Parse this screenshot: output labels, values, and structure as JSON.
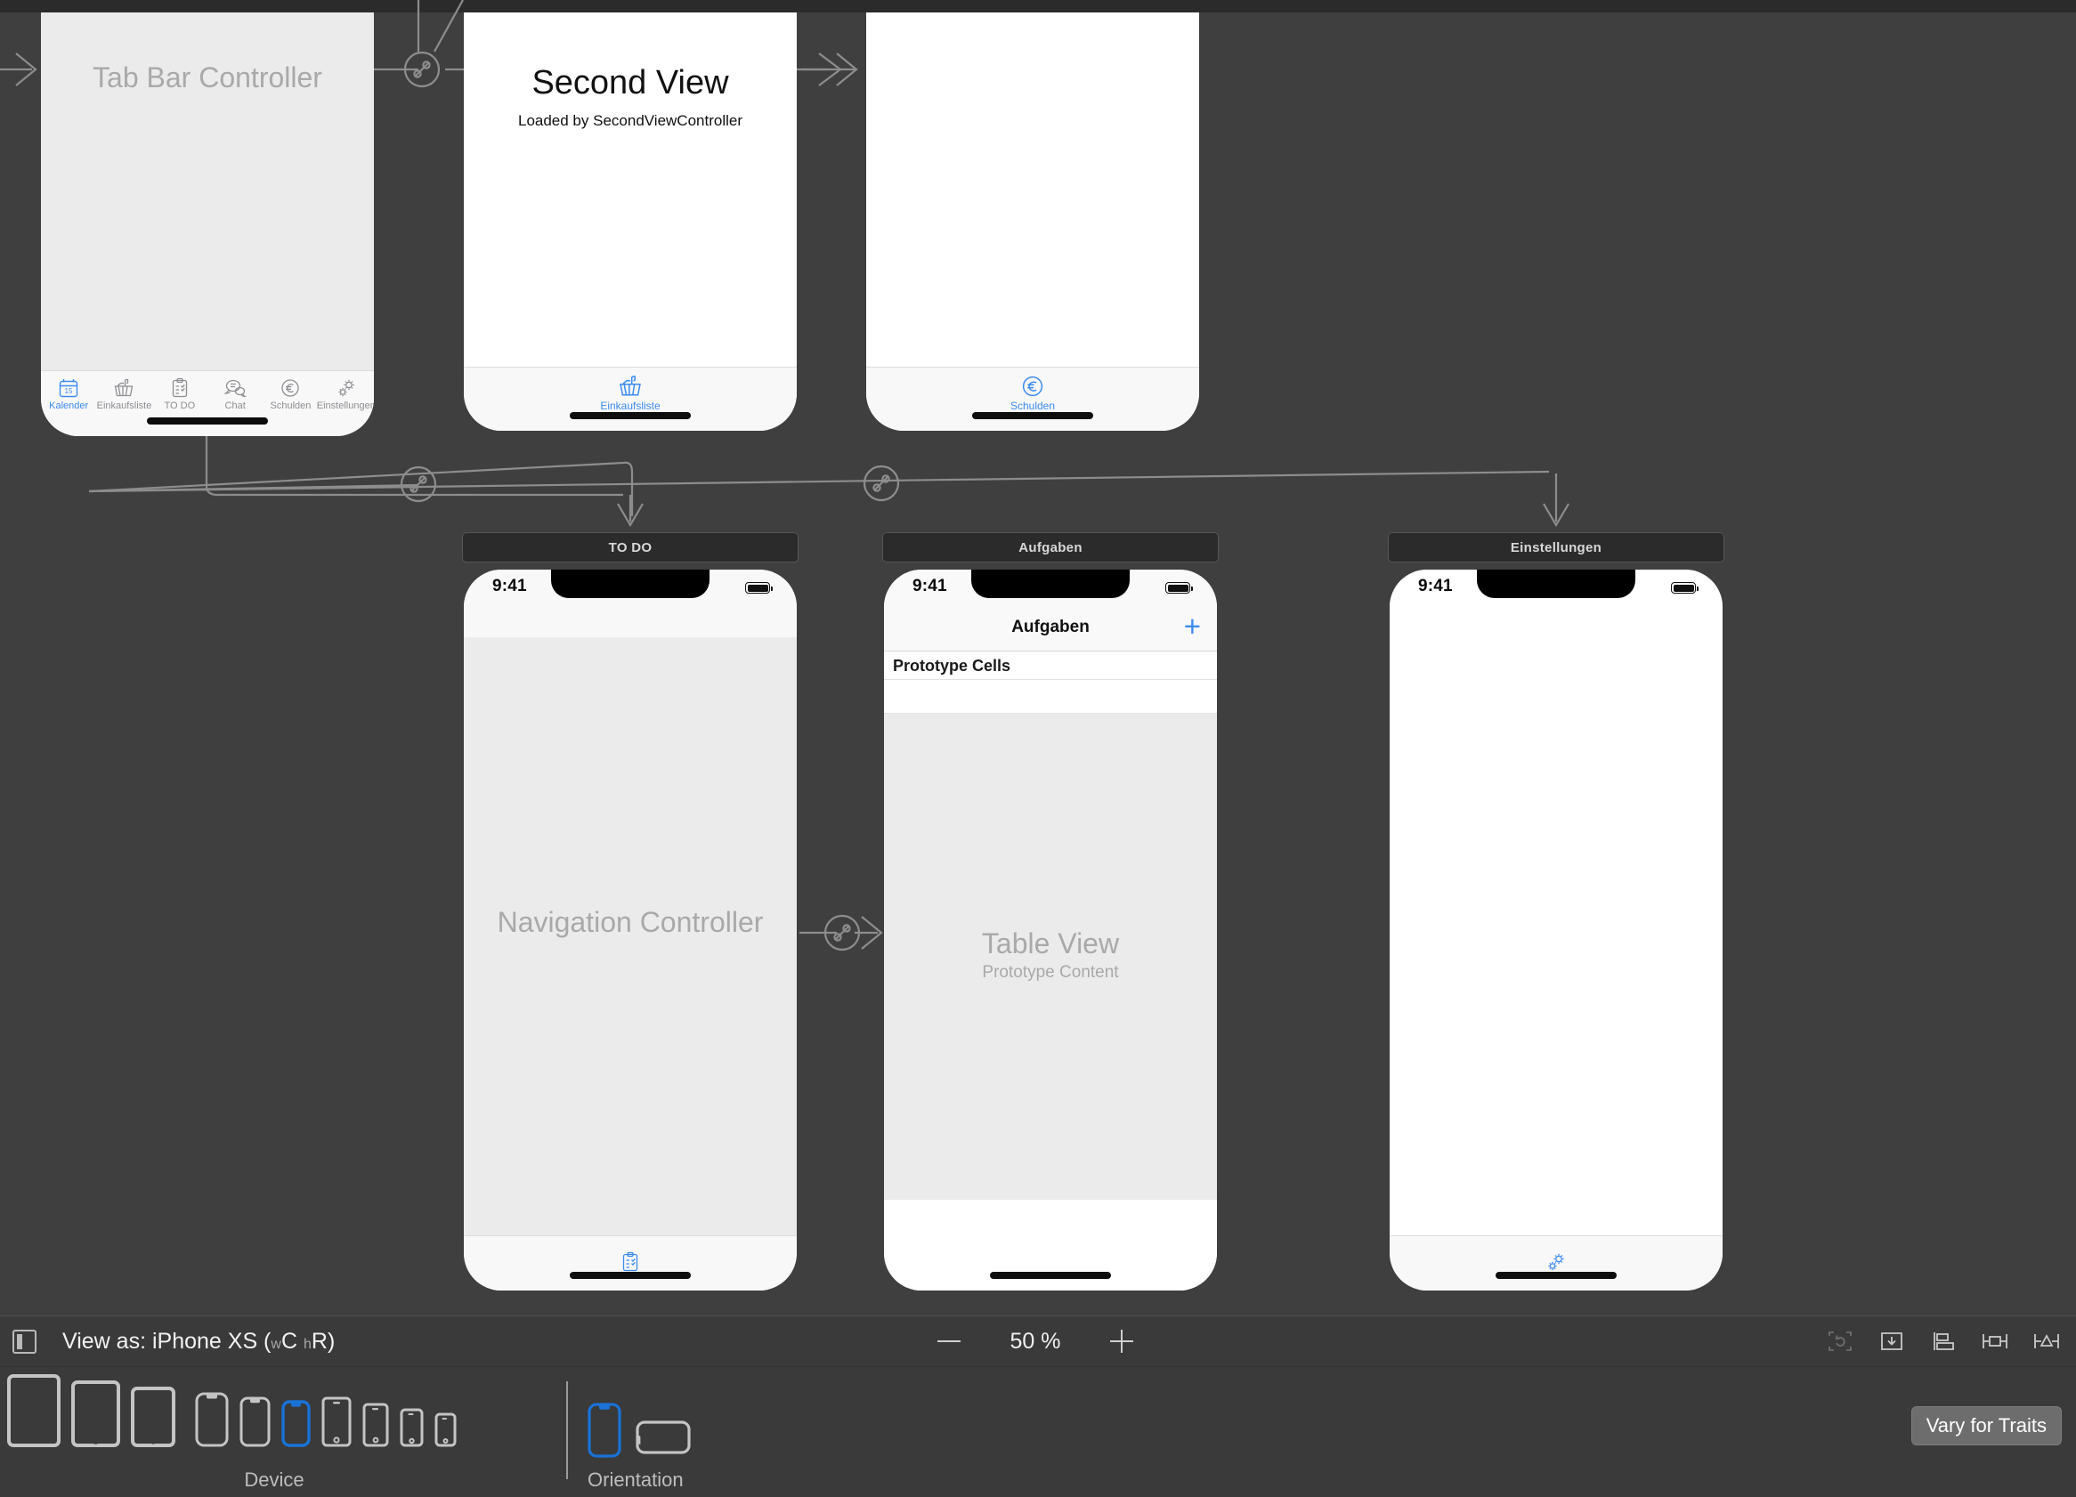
{
  "app": {
    "editor": "xcode-interface-builder-storyboard"
  },
  "canvas": {
    "scenes": [
      {
        "id": "tab-bar-controller",
        "placeholder_title": "Tab Bar Controller",
        "placeholder_sub": "",
        "tabbar": {
          "items": [
            {
              "label": "Kalender",
              "icon": "calendar-icon",
              "active": true
            },
            {
              "label": "Einkaufsliste",
              "icon": "basket-icon",
              "active": false
            },
            {
              "label": "TO DO",
              "icon": "clipboard-icon",
              "active": false
            },
            {
              "label": "Chat",
              "icon": "chat-bubbles-icon",
              "active": false
            },
            {
              "label": "Schulden",
              "icon": "euro-circle-icon",
              "active": false
            },
            {
              "label": "Einstellungen",
              "icon": "gears-icon",
              "active": false
            }
          ]
        }
      },
      {
        "id": "second-view",
        "title": "Second View",
        "subtitle": "Loaded by SecondViewController",
        "tabbar": {
          "items": [
            {
              "label": "Einkaufsliste",
              "icon": "basket-icon",
              "active": true
            }
          ]
        }
      },
      {
        "id": "schulden-view",
        "title": "",
        "subtitle": "",
        "tabbar": {
          "items": [
            {
              "label": "Schulden",
              "icon": "euro-circle-icon",
              "active": true
            }
          ]
        }
      },
      {
        "id": "todo-navigation-controller",
        "chip": "TO DO",
        "status_time": "9:41",
        "placeholder_title": "Navigation Controller",
        "tabbar": {
          "items": [
            {
              "label": "",
              "icon": "clipboard-icon",
              "active": true
            }
          ]
        }
      },
      {
        "id": "aufgaben-table-view",
        "chip": "Aufgaben",
        "status_time": "9:41",
        "nav_title": "Aufgaben",
        "nav_add": "+",
        "section_header": "Prototype Cells",
        "placeholder_title": "Table View",
        "placeholder_sub": "Prototype Content"
      },
      {
        "id": "einstellungen-view",
        "chip": "Einstellungen",
        "status_time": "9:41",
        "tabbar": {
          "items": [
            {
              "label": "",
              "icon": "gears-icon",
              "active": true
            }
          ]
        }
      }
    ]
  },
  "viewbar": {
    "toggle_icon": "show-document-outline-icon",
    "view_as_prefix": "View as: iPhone XS (",
    "trait_w_sub": "w",
    "trait_w": "C",
    "trait_h_sub": "h",
    "trait_h": "R",
    "view_as_suffix": ")",
    "zoom_out_icon": "minus-icon",
    "zoom_value": "50 %",
    "zoom_in_icon": "plus-icon",
    "tools": [
      {
        "name": "update-frames-icon",
        "enabled": false
      },
      {
        "name": "embed-in-icon",
        "enabled": true
      },
      {
        "name": "align-icon",
        "enabled": true
      },
      {
        "name": "add-new-constraints-icon",
        "enabled": true
      },
      {
        "name": "resolve-auto-layout-issues-icon",
        "enabled": true
      }
    ]
  },
  "devicebar": {
    "device_label": "Device",
    "orientation_label": "Orientation",
    "vary_button": "Vary for Traits",
    "devices": [
      {
        "name": "ipad-12in",
        "kind": "tablet",
        "w": 52,
        "h": 70,
        "selected": false
      },
      {
        "name": "ipad-11in",
        "kind": "tablet",
        "w": 48,
        "h": 65,
        "selected": false
      },
      {
        "name": "ipad-9in",
        "kind": "tablet",
        "w": 44,
        "h": 60,
        "selected": false
      },
      {
        "name": "iphone-xs-max",
        "kind": "notched",
        "w": 34,
        "h": 55,
        "selected": false
      },
      {
        "name": "iphone-xr",
        "kind": "notched",
        "w": 31,
        "h": 51,
        "selected": false
      },
      {
        "name": "iphone-xs",
        "kind": "notched",
        "w": 29,
        "h": 47,
        "selected": true
      },
      {
        "name": "iphone-8-plus",
        "kind": "home",
        "w": 30,
        "h": 50,
        "selected": false
      },
      {
        "name": "iphone-8",
        "kind": "home",
        "w": 26,
        "h": 43,
        "selected": false
      },
      {
        "name": "iphone-se",
        "kind": "home",
        "w": 23,
        "h": 38,
        "selected": false
      },
      {
        "name": "iphone-4s",
        "kind": "home",
        "w": 21,
        "h": 33,
        "selected": false
      }
    ],
    "orientations": [
      {
        "name": "portrait",
        "selected": true
      },
      {
        "name": "landscape",
        "selected": false
      }
    ]
  },
  "colors": {
    "canvas_bg": "#3f3f3f",
    "chrome_bg": "#3a3a3a",
    "accent_blue": "#3c8bf0",
    "selection_blue": "#1a72d6",
    "placeholder_gray": "#a9a9a9",
    "scene_chip_bg": "#2b2b2b"
  }
}
